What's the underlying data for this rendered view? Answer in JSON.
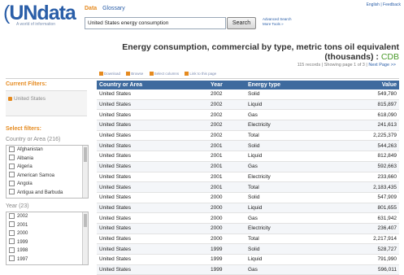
{
  "header": {
    "logo_text": "UNdata",
    "logo_tagline": "A world of information",
    "top_links": "English | Feedback",
    "nav": {
      "data": "Data",
      "glossary": "Glossary"
    },
    "search_value": "United States energy consumption",
    "search_button": "Search",
    "advanced_search": "Advanced Search",
    "more_tools": "More Tools »"
  },
  "title": {
    "main": "Energy consumption, commercial by type, metric tons oil equivalent (thousands)",
    "separator": " : ",
    "source": "CDB"
  },
  "records": {
    "info": "115 records | Showing page 1 of 3 |",
    "next": "Next Page >>"
  },
  "actions": [
    "Download",
    "Browse",
    "Select columns",
    "Link to this page"
  ],
  "sidebar": {
    "current_filters_label": "Current Filters:",
    "current_filter": "United States",
    "select_filters_label": "Select filters:",
    "country_group": "Country or Area (216)",
    "countries": [
      "Afghanistan",
      "Albania",
      "Algeria",
      "American Samoa",
      "Angola",
      "Antigua and Barbuda"
    ],
    "year_group": "Year (23)",
    "years": [
      "2002",
      "2001",
      "2000",
      "1999",
      "1998",
      "1997"
    ]
  },
  "table": {
    "headers": [
      "Country or Area",
      "Year",
      "Energy type",
      "Value"
    ],
    "rows": [
      [
        "United States",
        "2002",
        "Solid",
        "549,780"
      ],
      [
        "United States",
        "2002",
        "Liquid",
        "815,897"
      ],
      [
        "United States",
        "2002",
        "Gas",
        "618,090"
      ],
      [
        "United States",
        "2002",
        "Electricity",
        "241,613"
      ],
      [
        "United States",
        "2002",
        "Total",
        "2,225,379"
      ],
      [
        "United States",
        "2001",
        "Solid",
        "544,263"
      ],
      [
        "United States",
        "2001",
        "Liquid",
        "812,849"
      ],
      [
        "United States",
        "2001",
        "Gas",
        "592,663"
      ],
      [
        "United States",
        "2001",
        "Electricity",
        "233,660"
      ],
      [
        "United States",
        "2001",
        "Total",
        "2,183,435"
      ],
      [
        "United States",
        "2000",
        "Solid",
        "547,909"
      ],
      [
        "United States",
        "2000",
        "Liquid",
        "801,655"
      ],
      [
        "United States",
        "2000",
        "Gas",
        "631,942"
      ],
      [
        "United States",
        "2000",
        "Electricity",
        "236,407"
      ],
      [
        "United States",
        "2000",
        "Total",
        "2,217,914"
      ],
      [
        "United States",
        "1999",
        "Solid",
        "528,727"
      ],
      [
        "United States",
        "1999",
        "Liquid",
        "791,990"
      ],
      [
        "United States",
        "1999",
        "Gas",
        "596,011"
      ]
    ]
  },
  "colors": {
    "accent": "#e58a1f",
    "header_blue": "#3e6a9e",
    "link": "#2a5ea8",
    "cdb_green": "#4a9a2a"
  }
}
